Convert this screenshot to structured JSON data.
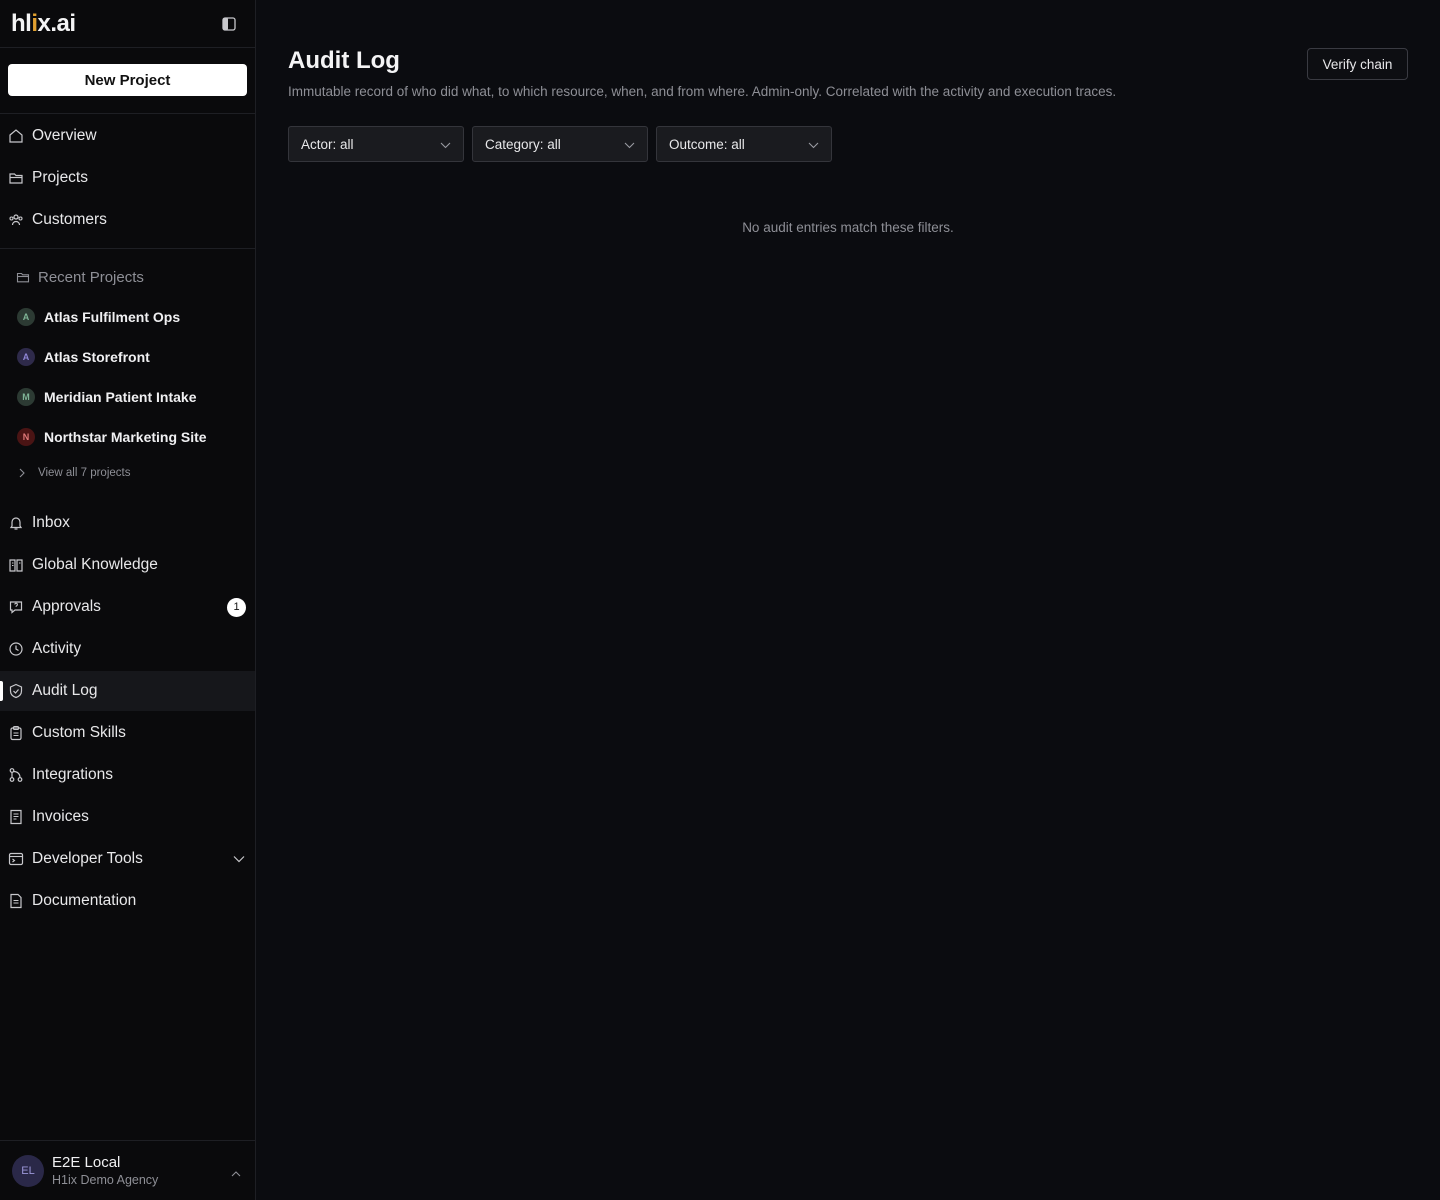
{
  "sidebar": {
    "logo": {
      "pre": "hl",
      "accent": "i",
      "post": "x.ai"
    },
    "new_project_label": "New Project",
    "top_nav": [
      {
        "label": "Overview",
        "icon": "home-icon"
      },
      {
        "label": "Projects",
        "icon": "folder-icon"
      },
      {
        "label": "Customers",
        "icon": "users-icon"
      }
    ],
    "recent": {
      "title": "Recent Projects",
      "items": [
        {
          "label": "Atlas Fulfilment Ops",
          "initial": "A",
          "bg": "#2c3a33",
          "fg": "#7fb496"
        },
        {
          "label": "Atlas Storefront",
          "initial": "A",
          "bg": "#2e2a4a",
          "fg": "#8f86d6"
        },
        {
          "label": "Meridian Patient Intake",
          "initial": "M",
          "bg": "#2c3a33",
          "fg": "#7fb496"
        },
        {
          "label": "Northstar Marketing Site",
          "initial": "N",
          "bg": "#4a1414",
          "fg": "#e07a7a"
        }
      ],
      "view_all": "View all 7 projects"
    },
    "bottom_nav": [
      {
        "label": "Inbox",
        "icon": "bell-icon"
      },
      {
        "label": "Global Knowledge",
        "icon": "book-icon"
      },
      {
        "label": "Approvals",
        "icon": "question-icon",
        "badge": "1"
      },
      {
        "label": "Activity",
        "icon": "clock-icon"
      },
      {
        "label": "Audit Log",
        "icon": "shield-check-icon",
        "active": true
      },
      {
        "label": "Custom Skills",
        "icon": "clipboard-icon"
      },
      {
        "label": "Integrations",
        "icon": "git-branch-icon"
      },
      {
        "label": "Invoices",
        "icon": "receipt-icon"
      },
      {
        "label": "Developer Tools",
        "icon": "terminal-icon",
        "expandable": true
      },
      {
        "label": "Documentation",
        "icon": "document-icon"
      }
    ],
    "user": {
      "initials": "EL",
      "name": "E2E Local",
      "org": "H1ix Demo Agency"
    }
  },
  "main": {
    "title": "Audit Log",
    "subtitle": "Immutable record of who did what, to which resource, when, and from where. Admin-only. Correlated with the activity and execution traces.",
    "verify_label": "Verify chain",
    "filters": [
      {
        "label": "Actor: all"
      },
      {
        "label": "Category: all"
      },
      {
        "label": "Outcome: all"
      }
    ],
    "empty_text": "No audit entries match these filters."
  }
}
